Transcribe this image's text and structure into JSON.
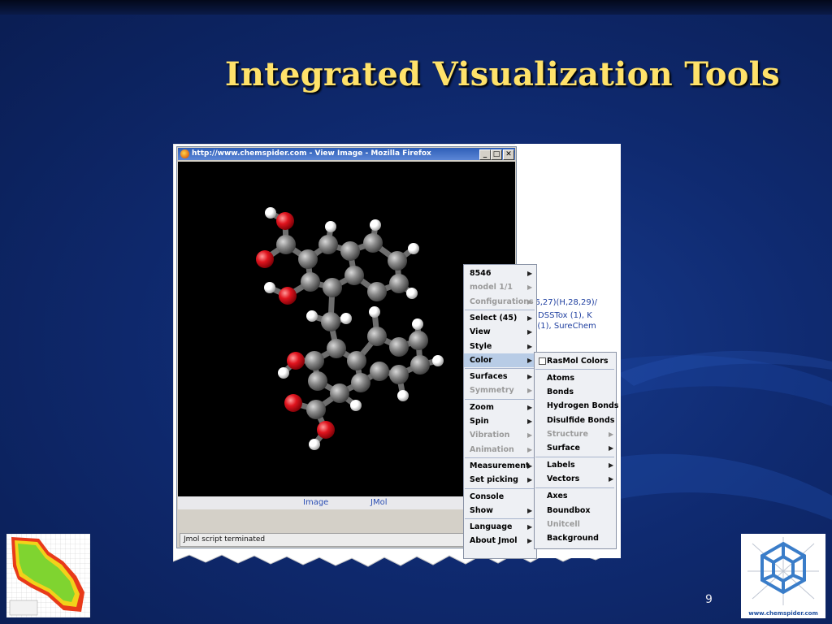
{
  "slide": {
    "title": "Integrated Visualization Tools",
    "page_number": "9"
  },
  "browser": {
    "window_title": "http://www.chemspider.com - View Image - Mozilla Firefox",
    "controls": {
      "minimize": "_",
      "maximize": "□",
      "close": "✕"
    },
    "links": {
      "image": "Image",
      "jmol": "JMol"
    },
    "status_text": "Jmol script terminated"
  },
  "background_page": {
    "line1": "26,27)(H,28,29)/",
    "line2": "A DSSTox (1), K",
    "line3": "e (1), SureChem"
  },
  "context_menu": {
    "items": [
      {
        "label": "8546",
        "has_submenu": true,
        "disabled": false
      },
      {
        "label": "model 1/1",
        "has_submenu": true,
        "disabled": true
      },
      {
        "label": "Configurations",
        "has_submenu": true,
        "disabled": true
      },
      {
        "label": "Select (45)",
        "has_submenu": true,
        "disabled": false
      },
      {
        "label": "View",
        "has_submenu": true,
        "disabled": false
      },
      {
        "label": "Style",
        "has_submenu": true,
        "disabled": false
      },
      {
        "label": "Color",
        "has_submenu": true,
        "disabled": false,
        "highlighted": true
      },
      {
        "label": "Surfaces",
        "has_submenu": true,
        "disabled": false
      },
      {
        "label": "Symmetry",
        "has_submenu": true,
        "disabled": true
      },
      {
        "label": "Zoom",
        "has_submenu": true,
        "disabled": false
      },
      {
        "label": "Spin",
        "has_submenu": true,
        "disabled": false
      },
      {
        "label": "Vibration",
        "has_submenu": true,
        "disabled": true
      },
      {
        "label": "Animation",
        "has_submenu": true,
        "disabled": true
      },
      {
        "label": "Measurement",
        "has_submenu": true,
        "disabled": false
      },
      {
        "label": "Set picking",
        "has_submenu": true,
        "disabled": false
      },
      {
        "label": "Console",
        "has_submenu": false,
        "disabled": false
      },
      {
        "label": "Show",
        "has_submenu": true,
        "disabled": false
      },
      {
        "label": "Language",
        "has_submenu": true,
        "disabled": false
      },
      {
        "label": "About Jmol",
        "has_submenu": true,
        "disabled": false
      }
    ]
  },
  "color_submenu": {
    "checkbox_item": {
      "label": "RasMol Colors",
      "checked": false
    },
    "items": [
      {
        "label": "Atoms",
        "disabled": false
      },
      {
        "label": "Bonds",
        "disabled": false
      },
      {
        "label": "Hydrogen Bonds",
        "disabled": false
      },
      {
        "label": "Disulfide Bonds",
        "disabled": false
      },
      {
        "label": "Structure",
        "disabled": true
      },
      {
        "label": "Surface",
        "disabled": false
      },
      {
        "label": "Labels",
        "disabled": false
      },
      {
        "label": "Vectors",
        "disabled": false
      },
      {
        "label": "Axes",
        "disabled": false
      },
      {
        "label": "Boundbox",
        "disabled": false
      },
      {
        "label": "Unitcell",
        "disabled": true
      },
      {
        "label": "Background",
        "disabled": false
      }
    ]
  },
  "logos": {
    "right_logo_text": "www.chemspider.com"
  },
  "colors": {
    "title": "#ffe26a",
    "carbon": "#8a8a8a",
    "oxygen": "#e0141e",
    "hydrogen": "#ffffff",
    "menu_highlight": "#b8cce6"
  },
  "icons": {
    "browser": "firefox-icon",
    "submenu_arrow": "chevron-right-icon"
  }
}
